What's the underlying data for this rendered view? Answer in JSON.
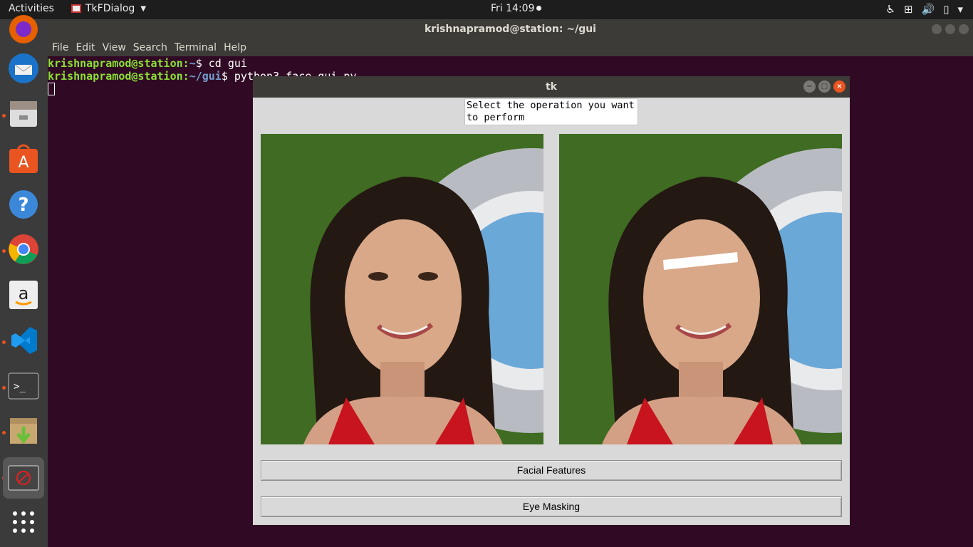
{
  "topbar": {
    "activities": "Activities",
    "app_name": "TkFDialog",
    "clock": "Fri 14:09",
    "tray_icons": [
      "accessibility-icon",
      "network-icon",
      "volume-icon",
      "battery-icon",
      "power-menu-icon"
    ]
  },
  "dock": {
    "items": [
      {
        "name": "firefox",
        "running": false
      },
      {
        "name": "thunderbird",
        "running": false
      },
      {
        "name": "files",
        "running": true
      },
      {
        "name": "software",
        "running": false
      },
      {
        "name": "help",
        "running": false
      },
      {
        "name": "chrome",
        "running": true
      },
      {
        "name": "amazon",
        "running": false
      },
      {
        "name": "vscode",
        "running": true
      },
      {
        "name": "terminal",
        "running": true
      },
      {
        "name": "installer",
        "running": true
      },
      {
        "name": "tk-app",
        "running": true
      },
      {
        "name": "show-apps",
        "running": false
      }
    ]
  },
  "terminal": {
    "title": "krishnapramod@station: ~/gui",
    "menu": [
      "File",
      "Edit",
      "View",
      "Search",
      "Terminal",
      "Help"
    ],
    "lines": [
      {
        "user": "krishnapramod@station",
        "path": "~",
        "cmd": "cd gui"
      },
      {
        "user": "krishnapramod@station",
        "path": "~/gui",
        "cmd": "python3 face_gui.py"
      }
    ]
  },
  "tk": {
    "title": "tk",
    "prompt": "Select the operation you want to perform",
    "buttons": {
      "facial": "Facial Features",
      "eye": "Eye Masking"
    },
    "colors": {
      "background": "#d9d9d9",
      "accent_close": "#e95420"
    }
  }
}
